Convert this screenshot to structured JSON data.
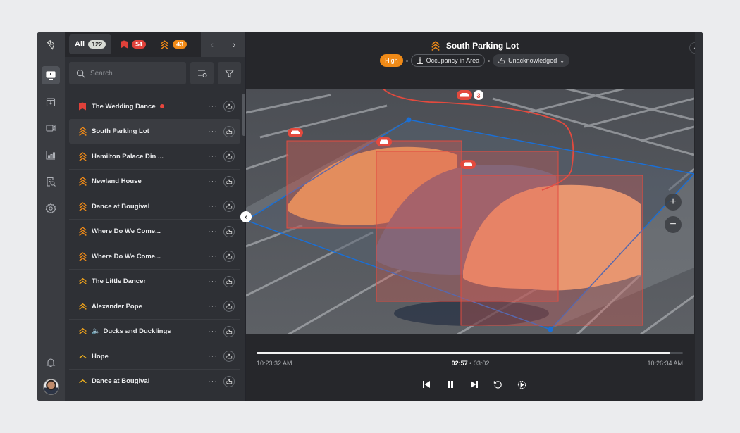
{
  "rail": {
    "items": [
      {
        "name": "logo",
        "icon": "logo-icon"
      },
      {
        "name": "monitor",
        "icon": "monitor-alert-icon",
        "active": true
      },
      {
        "name": "inbox",
        "icon": "inbox-download-icon"
      },
      {
        "name": "camera",
        "icon": "video-camera-icon"
      },
      {
        "name": "analytics",
        "icon": "bar-chart-icon"
      },
      {
        "name": "search-report",
        "icon": "document-search-icon"
      },
      {
        "name": "settings",
        "icon": "gear-icon"
      },
      {
        "name": "notifications",
        "icon": "bell-icon"
      }
    ]
  },
  "tabs": [
    {
      "label": "All",
      "count": "122",
      "kind": "all"
    },
    {
      "label": "",
      "count": "54",
      "kind": "critical"
    },
    {
      "label": "",
      "count": "43",
      "kind": "high"
    },
    {
      "label": "",
      "count": "",
      "kind": "medium"
    }
  ],
  "search": {
    "placeholder": "Search",
    "value": ""
  },
  "items": [
    {
      "name": "The Wedding Dance",
      "priority": "critical",
      "unread": true
    },
    {
      "name": "South Parking Lot",
      "priority": "high",
      "selected": true
    },
    {
      "name": "Hamilton Palace Din ...",
      "priority": "high"
    },
    {
      "name": "Newland House",
      "priority": "high"
    },
    {
      "name": "Dance at Bougival",
      "priority": "high"
    },
    {
      "name": "Where Do We Come...",
      "priority": "high"
    },
    {
      "name": "Where Do We Come...",
      "priority": "high"
    },
    {
      "name": "The Little Dancer",
      "priority": "medium"
    },
    {
      "name": "Alexander Pope",
      "priority": "medium"
    },
    {
      "name": "Ducks and Ducklings",
      "priority": "medium",
      "audio": true
    },
    {
      "name": "Hope",
      "priority": "low"
    },
    {
      "name": "Dance at Bougival",
      "priority": "low"
    }
  ],
  "header": {
    "title": "South Parking Lot",
    "severity": "High",
    "rule": "Occupancy in Area",
    "status": "Unacknowledged"
  },
  "video": {
    "track_count": "3",
    "detections": [
      "car",
      "car",
      "car"
    ]
  },
  "playback": {
    "start_time": "10:23:32 AM",
    "end_time": "10:26:34 AM",
    "current": "02:57",
    "duration": "03:02",
    "progress_pct": 97
  },
  "colors": {
    "critical": "#e0413a",
    "high": "#f08a17",
    "medium": "#f0a21a",
    "low": "#f2b21c",
    "zone": "#1a6fd6"
  }
}
